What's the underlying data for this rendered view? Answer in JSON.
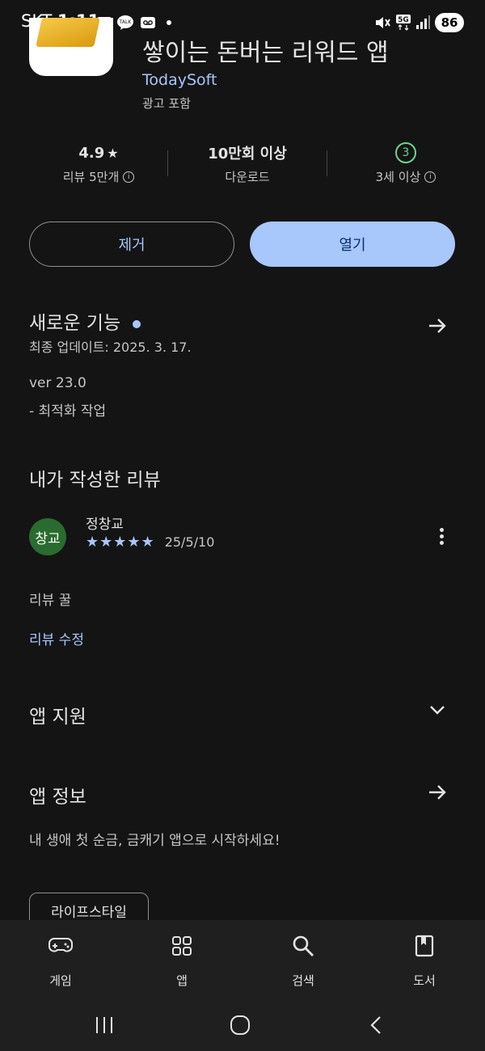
{
  "status_bar": {
    "carrier": "SKT",
    "time": "1:11",
    "icons": [
      "link-icon",
      "talk-icon",
      "voicemail-icon",
      "dot-icon",
      "mute-icon",
      "5g-icon",
      "signal-icon"
    ],
    "battery": "86"
  },
  "app": {
    "title": "쌓이는 돈버는 리워드 앱",
    "developer": "TodaySoft",
    "ads_notice": "광고 포함"
  },
  "stats": {
    "rating_value": "4.9",
    "rating_label": "리뷰 5만개",
    "downloads_value": "10만회 이상",
    "downloads_label": "다운로드",
    "age_value": "3",
    "age_label": "3세 이상"
  },
  "buttons": {
    "remove": "제거",
    "open": "열기"
  },
  "whats_new": {
    "title": "새로운 기능",
    "updated": "최종 업데이트: 2025. 3. 17.",
    "version": "ver 23.0",
    "notes": "- 최적화 작업"
  },
  "my_review": {
    "title": "내가 작성한 리뷰",
    "avatar_text": "창교",
    "author": "정창교",
    "stars": 5,
    "date": "25/5/10",
    "text": "리뷰 꿀",
    "edit_link": "리뷰 수정"
  },
  "app_support": {
    "title": "앱 지원"
  },
  "app_info": {
    "title": "앱 정보",
    "description": "내 생애 첫 순금, 금캐기 앱으로 시작하세요!",
    "category_chip": "라이프스타일"
  },
  "bottom_nav": [
    {
      "label": "게임",
      "icon": "gamepad-icon"
    },
    {
      "label": "앱",
      "icon": "apps-grid-icon"
    },
    {
      "label": "검색",
      "icon": "search-icon"
    },
    {
      "label": "도서",
      "icon": "book-icon"
    }
  ],
  "colors": {
    "background": "#141414",
    "accent": "#a8c7fa",
    "rating_green": "#6dd58c",
    "avatar_green": "#2a6b2f"
  }
}
